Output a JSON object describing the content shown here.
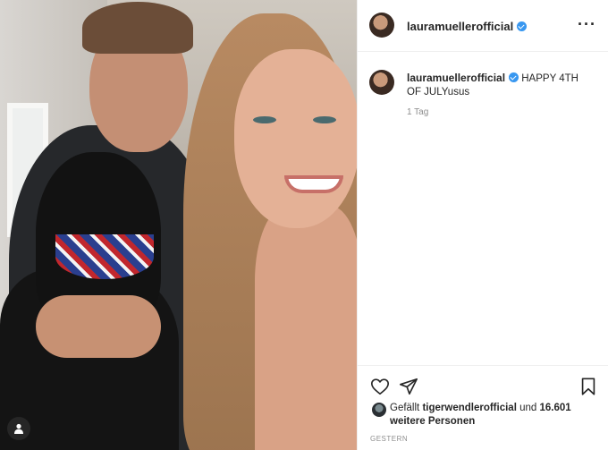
{
  "post": {
    "username": "lauramuellerofficial",
    "more_icon": "more-horizontal-icon"
  },
  "caption": {
    "username": "lauramuellerofficial",
    "text": "HAPPY 4TH OF JULYusus",
    "age": "1 Tag"
  },
  "likes": {
    "prefix": "Gefällt",
    "liker": "tigerwendlerofficial",
    "connector": "und",
    "count_text": "16.601 weitere Personen"
  },
  "date_label": "GESTERN",
  "icons": {
    "like": "heart-icon",
    "share": "send-icon",
    "save": "bookmark-icon",
    "tagged_user": "user-tag-icon"
  },
  "colors": {
    "verified": "#3897f0",
    "text": "#262626",
    "muted": "#8e8e8e"
  }
}
